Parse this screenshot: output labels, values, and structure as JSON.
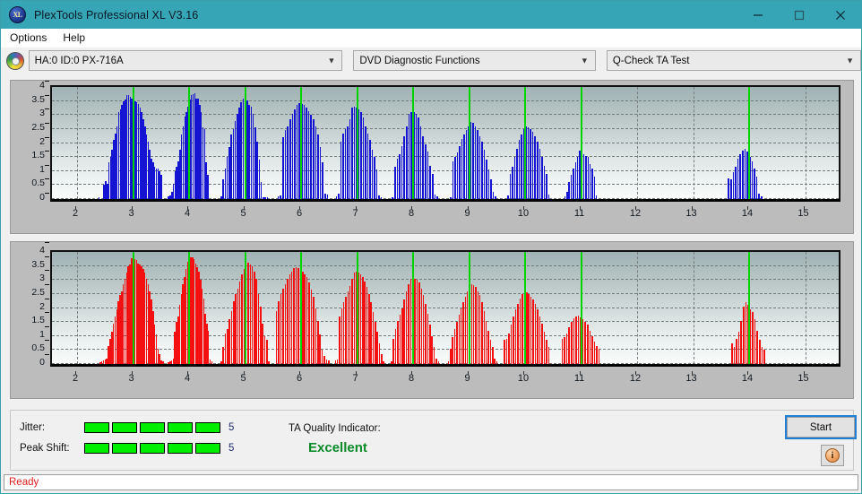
{
  "window": {
    "title": "PlexTools Professional XL V3.16",
    "app_icon": "xl-logo-icon",
    "minimize_label": "Minimize",
    "maximize_label": "Maximize",
    "close_label": "Close",
    "titlebar_color": "#36a5b5"
  },
  "menubar": {
    "items": [
      "Options",
      "Help"
    ]
  },
  "selectors": {
    "drive": {
      "value": "HA:0 ID:0  PX-716A",
      "icon": "disc-icon"
    },
    "function": {
      "value": "DVD Diagnostic Functions"
    },
    "test": {
      "value": "Q-Check TA Test"
    }
  },
  "chart_data": [
    {
      "id": "top",
      "type": "bar",
      "title": "",
      "series_name": "Jitter",
      "color": "#1414d2",
      "xlabel": "",
      "ylabel": "",
      "xlim": [
        1.55,
        15.6
      ],
      "ylim": [
        0,
        4
      ],
      "yticks": [
        0,
        0.5,
        1,
        1.5,
        2,
        2.5,
        3,
        3.5,
        4
      ],
      "xticks": [
        2,
        3,
        4,
        5,
        6,
        7,
        8,
        9,
        10,
        11,
        12,
        13,
        14,
        15
      ],
      "grid": true,
      "markers": [
        3,
        4,
        5,
        6,
        7,
        8,
        9,
        10,
        11,
        14
      ],
      "marker_color": "#00d400",
      "bar_step": 0.04,
      "groups": [
        {
          "center": 3.0,
          "peak": 3.7,
          "start": 2.38,
          "end": 3.52,
          "values": [
            0.08,
            0.0,
            0.0,
            0.5,
            0.65,
            0.55,
            1.3,
            1.5,
            1.75,
            2.1,
            2.35,
            2.6,
            3.1,
            3.2,
            3.35,
            3.5,
            3.55,
            3.7,
            3.7,
            3.65,
            3.58,
            3.5,
            3.5,
            3.45,
            3.4,
            3.25,
            3.1,
            2.85,
            2.6,
            2.3,
            2.05,
            1.75,
            1.45,
            1.3,
            1.15,
            1.1,
            1.1,
            1.0,
            0.85
          ]
        },
        {
          "center": 4.0,
          "peak": 3.78,
          "start": 3.62,
          "end": 4.35,
          "values": [
            0.1,
            0.12,
            0.25,
            0.55,
            1.0,
            1.15,
            1.35,
            1.75,
            2.3,
            2.6,
            2.95,
            3.1,
            3.3,
            3.55,
            3.7,
            3.75,
            3.78,
            3.6,
            3.58,
            3.35,
            3.1,
            2.55,
            2.5,
            1.3,
            0.88
          ]
        },
        {
          "center": 5.0,
          "peak": 3.6,
          "start": 4.56,
          "end": 5.42,
          "values": [
            0.1,
            0.72,
            1.1,
            1.5,
            1.85,
            2.3,
            2.5,
            2.8,
            3.05,
            3.25,
            3.45,
            3.6,
            3.55,
            3.52,
            3.35,
            3.3,
            3.05,
            2.55,
            2.05,
            1.4,
            0.6,
            0.08,
            0.08,
            0.05
          ]
        },
        {
          "center": 6.0,
          "peak": 3.42,
          "start": 5.58,
          "end": 6.5,
          "values": [
            0.1,
            0.12,
            2.2,
            2.45,
            2.6,
            2.85,
            3.05,
            3.2,
            3.35,
            3.42,
            3.4,
            3.35,
            3.25,
            3.15,
            3.0,
            2.85,
            2.6,
            2.3,
            1.85,
            1.3,
            0.2,
            0.15
          ]
        },
        {
          "center": 7.0,
          "peak": 3.3,
          "start": 6.62,
          "end": 7.46,
          "values": [
            0.1,
            0.2,
            2.05,
            2.35,
            2.5,
            2.6,
            2.85,
            3.25,
            3.3,
            3.25,
            3.2,
            3.1,
            2.9,
            2.6,
            2.35,
            2.1,
            1.75,
            1.5,
            1.05,
            0.12,
            0.08
          ]
        },
        {
          "center": 8.0,
          "peak": 3.12,
          "start": 7.62,
          "end": 8.46,
          "values": [
            0.08,
            1.15,
            1.45,
            1.6,
            1.9,
            2.25,
            2.6,
            3.05,
            3.12,
            3.1,
            3.05,
            2.9,
            2.6,
            2.25,
            1.95,
            1.7,
            1.2,
            0.9,
            0.15,
            0.1
          ]
        },
        {
          "center": 9.05,
          "peak": 2.75,
          "start": 8.66,
          "end": 9.5,
          "values": [
            0.08,
            1.35,
            1.5,
            1.65,
            1.9,
            2.15,
            2.3,
            2.45,
            2.6,
            2.75,
            2.72,
            2.6,
            2.45,
            2.25,
            2.05,
            1.75,
            1.4,
            1.05,
            0.7,
            0.25,
            0.1
          ]
        },
        {
          "center": 10.05,
          "peak": 2.6,
          "start": 9.68,
          "end": 10.45,
          "values": [
            0.12,
            0.9,
            1.15,
            1.5,
            1.8,
            2.1,
            2.3,
            2.5,
            2.6,
            2.55,
            2.5,
            2.4,
            2.25,
            2.05,
            1.8,
            1.5,
            1.2,
            0.9,
            0.15
          ]
        },
        {
          "center": 11.0,
          "peak": 1.72,
          "start": 10.7,
          "end": 11.3,
          "values": [
            0.1,
            0.25,
            0.6,
            0.85,
            1.1,
            1.3,
            1.5,
            1.72,
            1.65,
            1.6,
            1.55,
            1.5,
            1.25,
            1.1,
            0.8,
            0.12
          ]
        },
        {
          "center": 13.95,
          "peak": 1.78,
          "start": 13.62,
          "end": 14.25,
          "values": [
            0.75,
            0.7,
            0.95,
            1.15,
            1.45,
            1.6,
            1.72,
            1.78,
            1.7,
            1.5,
            1.35,
            1.1,
            0.8,
            0.2,
            0.1
          ]
        }
      ]
    },
    {
      "id": "bottom",
      "type": "bar",
      "title": "",
      "series_name": "Peak Shift",
      "color": "#f41010",
      "xlabel": "",
      "ylabel": "",
      "xlim": [
        1.55,
        15.6
      ],
      "ylim": [
        0,
        4
      ],
      "yticks": [
        0,
        0.5,
        1,
        1.5,
        2,
        2.5,
        3,
        3.5,
        4
      ],
      "xticks": [
        2,
        3,
        4,
        5,
        6,
        7,
        8,
        9,
        10,
        11,
        12,
        13,
        14,
        15
      ],
      "grid": true,
      "markers": [
        3,
        4,
        5,
        6,
        7,
        8,
        9,
        10,
        11,
        14
      ],
      "marker_color": "#00d400",
      "bar_step": 0.035,
      "groups": [
        {
          "center": 3.0,
          "peak": 3.8,
          "start": 2.4,
          "end": 3.55,
          "values": [
            0.08,
            0.1,
            0.12,
            0.15,
            0.2,
            0.65,
            0.9,
            1.15,
            1.45,
            1.7,
            1.95,
            2.25,
            2.45,
            2.6,
            2.85,
            3.05,
            3.25,
            3.5,
            3.55,
            3.78,
            3.8,
            3.75,
            3.7,
            3.6,
            3.55,
            3.5,
            3.4,
            3.25,
            3.05,
            2.85,
            2.6,
            2.3,
            1.9,
            1.4,
            1.05,
            0.55,
            0.35,
            0.12,
            0.1
          ]
        },
        {
          "center": 4.0,
          "peak": 3.82,
          "start": 3.62,
          "end": 4.42,
          "values": [
            0.08,
            0.1,
            0.12,
            0.2,
            1.15,
            1.5,
            1.7,
            2.1,
            2.5,
            2.85,
            3.1,
            3.4,
            3.65,
            3.75,
            3.8,
            3.82,
            3.75,
            3.6,
            3.45,
            3.3,
            3.0,
            2.7,
            2.35,
            1.8,
            1.45,
            1.18,
            0.15,
            0.1
          ]
        },
        {
          "center": 5.0,
          "peak": 3.62,
          "start": 4.56,
          "end": 5.45,
          "values": [
            0.1,
            0.62,
            1.1,
            1.25,
            1.6,
            1.9,
            2.25,
            2.5,
            2.7,
            2.95,
            3.2,
            3.4,
            3.6,
            3.62,
            3.55,
            3.5,
            3.3,
            3.05,
            2.5,
            2.05,
            1.45,
            1.0,
            0.88,
            0.1
          ]
        },
        {
          "center": 6.0,
          "peak": 3.45,
          "start": 5.55,
          "end": 6.52,
          "values": [
            1.9,
            2.25,
            2.5,
            2.7,
            2.85,
            3.05,
            3.2,
            3.3,
            3.42,
            3.45,
            3.42,
            3.38,
            3.3,
            3.2,
            3.1,
            2.9,
            2.65,
            2.4,
            2.0,
            1.55,
            1.05,
            0.5,
            0.3,
            0.15,
            0.12
          ]
        },
        {
          "center": 7.0,
          "peak": 3.3,
          "start": 6.6,
          "end": 7.5,
          "values": [
            0.12,
            0.15,
            1.7,
            2.0,
            2.2,
            2.4,
            2.6,
            2.8,
            3.05,
            3.25,
            3.3,
            3.25,
            3.2,
            3.1,
            2.95,
            2.75,
            2.5,
            2.2,
            1.85,
            1.5,
            1.15,
            0.75,
            0.35,
            0.1
          ]
        },
        {
          "center": 8.0,
          "peak": 3.1,
          "start": 7.6,
          "end": 8.48,
          "values": [
            0.1,
            0.9,
            1.25,
            1.55,
            1.75,
            2.0,
            2.3,
            2.6,
            2.85,
            3.05,
            3.1,
            3.05,
            3.0,
            2.9,
            2.7,
            2.45,
            2.15,
            1.8,
            1.4,
            1.0,
            0.6,
            0.2,
            0.1
          ]
        },
        {
          "center": 9.0,
          "peak": 2.85,
          "start": 8.62,
          "end": 9.52,
          "values": [
            0.1,
            0.55,
            0.95,
            1.25,
            1.5,
            1.75,
            2.0,
            2.2,
            2.4,
            2.6,
            2.8,
            2.85,
            2.82,
            2.75,
            2.6,
            2.45,
            2.2,
            1.9,
            1.55,
            1.2,
            0.85,
            0.6,
            0.2,
            0.1
          ]
        },
        {
          "center": 10.0,
          "peak": 2.6,
          "start": 9.62,
          "end": 10.45,
          "values": [
            0.85,
            0.9,
            1.1,
            1.4,
            1.7,
            1.95,
            2.15,
            2.35,
            2.5,
            2.6,
            2.55,
            2.5,
            2.4,
            2.3,
            2.15,
            1.95,
            1.7,
            1.45,
            1.15,
            0.85,
            0.6
          ]
        },
        {
          "center": 11.0,
          "peak": 1.72,
          "start": 10.65,
          "end": 11.35,
          "values": [
            0.9,
            0.95,
            1.1,
            1.3,
            1.5,
            1.62,
            1.7,
            1.72,
            1.68,
            1.6,
            1.5,
            1.4,
            1.2,
            1.0,
            0.8,
            0.65,
            0.55
          ]
        },
        {
          "center": 14.0,
          "peak": 2.2,
          "start": 13.68,
          "end": 14.3,
          "values": [
            0.75,
            0.6,
            0.9,
            1.15,
            1.55,
            2.05,
            2.2,
            2.1,
            1.95,
            1.85,
            1.6,
            1.2,
            0.85,
            0.6,
            0.5
          ]
        }
      ]
    }
  ],
  "metrics": {
    "jitter": {
      "label": "Jitter:",
      "value": "5",
      "filled": 5,
      "total": 5,
      "led_color": "#00ef00"
    },
    "peak_shift": {
      "label": "Peak Shift:",
      "value": "5",
      "filled": 5,
      "total": 5,
      "led_color": "#00ef00"
    }
  },
  "quality": {
    "label": "TA Quality Indicator:",
    "value": "Excellent",
    "color": "#0b8a27"
  },
  "actions": {
    "start_label": "Start",
    "info_label": "i"
  },
  "statusbar": {
    "text": "Ready",
    "color": "#e02020"
  }
}
